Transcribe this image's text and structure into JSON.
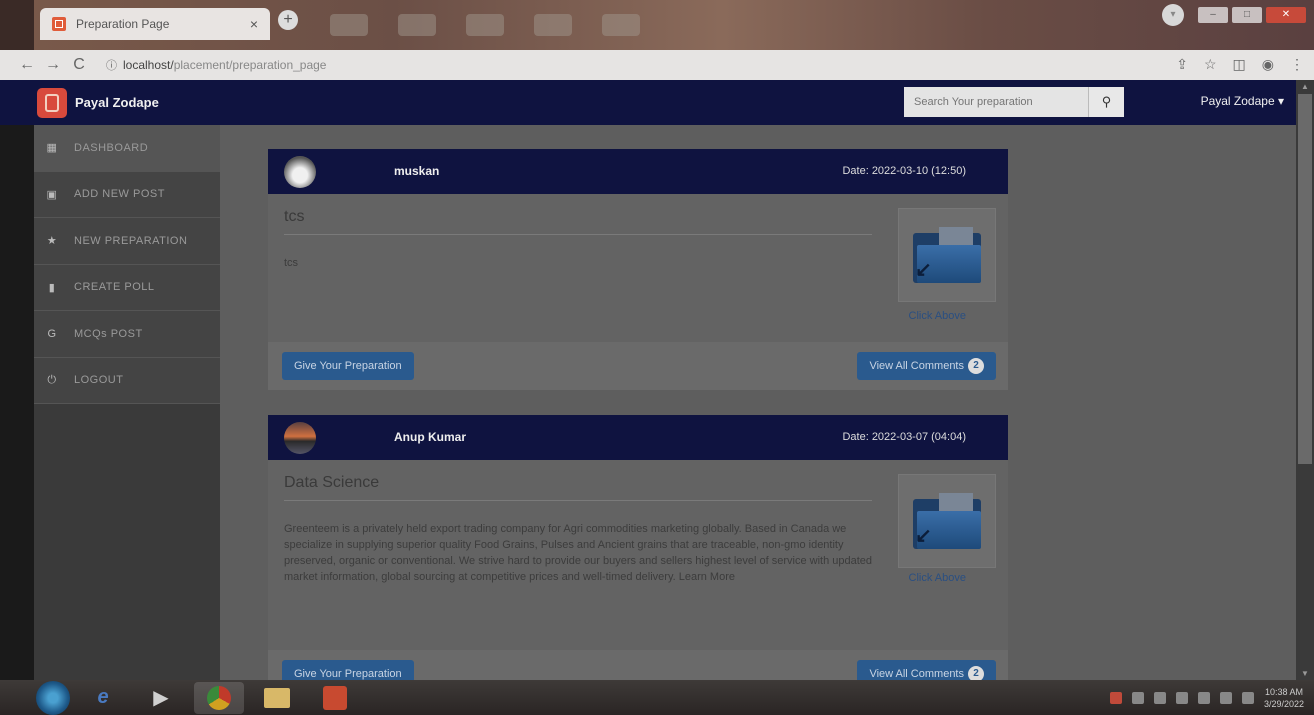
{
  "browser": {
    "tab_title": "Preparation Page",
    "tab_close": "×",
    "new_tab": "+",
    "url_host": "localhost/",
    "url_path": "placement/preparation_page",
    "info_icon": "ⓘ"
  },
  "navbar": {
    "brand": "Payal Zodape",
    "search_placeholder": "Search Your preparation",
    "search_icon": "⚲",
    "user_menu": "Payal Zodape ▾"
  },
  "sidebar": {
    "items": [
      {
        "label": "DASHBOARD",
        "icon": "▦"
      },
      {
        "label": "ADD NEW POST",
        "icon": "▣"
      },
      {
        "label": "NEW PREPARATION",
        "icon": "★"
      },
      {
        "label": "CREATE POLL",
        "icon": "▮"
      },
      {
        "label": "MCQs POST",
        "icon": "G"
      },
      {
        "label": "LOGOUT",
        "icon": "⏻"
      }
    ]
  },
  "posts": [
    {
      "author": "muskan",
      "date": "Date: 2022-03-10 (12:50)",
      "title": "tcs",
      "text": "tcs",
      "click_label": "Click Above",
      "prepare_label": "Give Your Preparation",
      "comments_label": "View All Comments",
      "comments_count": "2"
    },
    {
      "author": "Anup Kumar",
      "date": "Date: 2022-03-07 (04:04)",
      "title": "Data Science",
      "text": "Greenteem is a privately held export trading company for Agri commodities marketing globally. Based in Canada we specialize in supplying superior quality Food Grains, Pulses and Ancient grains that are traceable, non-gmo identity preserved, organic or conventional. We strive hard to provide our buyers and sellers highest level of service with updated market information, global sourcing at competitive prices and well-timed delivery. Learn More",
      "click_label": "Click Above",
      "prepare_label": "Give Your Preparation",
      "comments_label": "View All Comments",
      "comments_count": "2"
    }
  ],
  "taskbar": {
    "clock_time": "10:38 AM",
    "clock_date": "3/29/2022"
  }
}
